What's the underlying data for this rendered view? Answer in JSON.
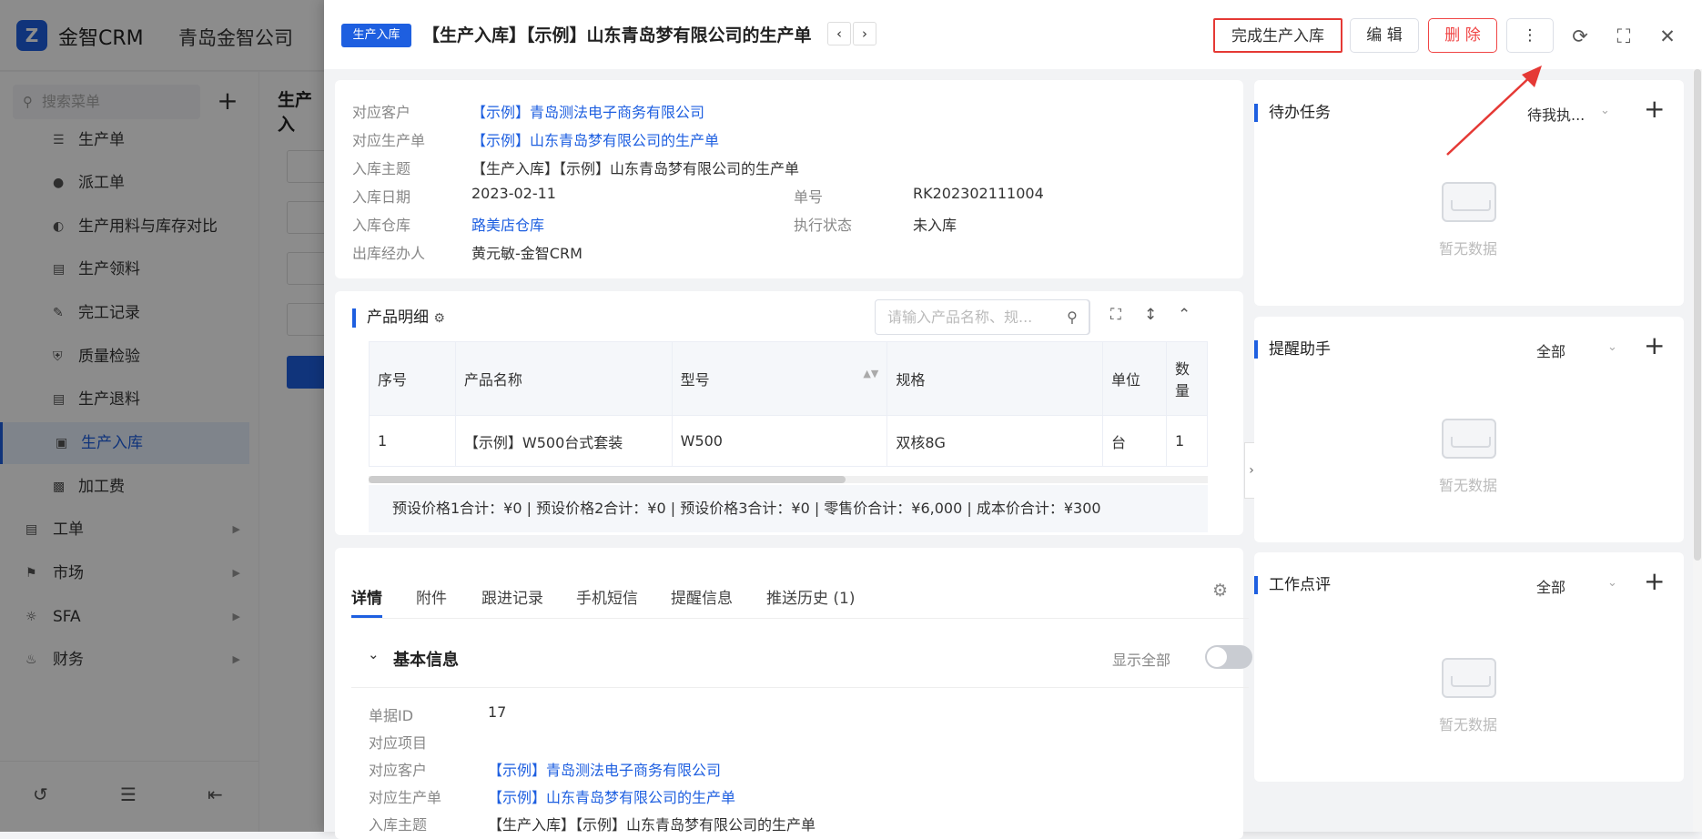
{
  "app": {
    "brand": "金智CRM",
    "company": "青岛金智公司"
  },
  "sidebar": {
    "search_placeholder": "搜索菜单",
    "items": [
      {
        "label": "生产单"
      },
      {
        "label": "派工单"
      },
      {
        "label": "生产用料与库存对比"
      },
      {
        "label": "生产领料"
      },
      {
        "label": "完工记录"
      },
      {
        "label": "质量检验"
      },
      {
        "label": "生产退料"
      },
      {
        "label": "生产入库",
        "active": true
      },
      {
        "label": "加工费"
      }
    ],
    "groups": [
      {
        "label": "工单"
      },
      {
        "label": "市场"
      },
      {
        "label": "SFA"
      },
      {
        "label": "财务"
      }
    ]
  },
  "list_pane": {
    "title": "生产入"
  },
  "header": {
    "tag": "生产入库",
    "title": "【生产入库】【示例】山东青岛梦有限公司的生产单",
    "buttons": {
      "complete": "完成生产入库",
      "edit": "编 辑",
      "delete": "删 除"
    }
  },
  "summary": {
    "fields": [
      {
        "label": "对应客户",
        "value": "【示例】青岛测法电子商务有限公司"
      },
      {
        "label": "对应生产单",
        "value": "【示例】山东青岛梦有限公司的生产单"
      },
      {
        "label": "入库主题",
        "value": "【生产入库】【示例】山东青岛梦有限公司的生产单"
      },
      {
        "label": "入库日期",
        "value": "2023-02-11"
      },
      {
        "label": "入库仓库",
        "value": "路美店仓库"
      },
      {
        "label": "出库经办人",
        "value": "黄元敏-金智CRM"
      },
      {
        "label": "单号",
        "value": "RK202302111004"
      },
      {
        "label": "执行状态",
        "value": "未入库"
      }
    ]
  },
  "products": {
    "title": "产品明细",
    "search_placeholder": "请输入产品名称、规...",
    "columns": [
      "序号",
      "产品名称",
      "型号",
      "规格",
      "单位",
      "数量"
    ],
    "rows": [
      {
        "index": "1",
        "name": "【示例】W500台式套装",
        "model": "W500",
        "spec": "双核8G",
        "unit": "台",
        "qty": "1"
      }
    ],
    "totals": "预设价格1合计：¥0 |   预设价格2合计：¥0 |   预设价格3合计：¥0 |   零售价合计：¥6,000 |   成本价合计：¥300"
  },
  "tabs": [
    {
      "label": "详情",
      "active": true
    },
    {
      "label": "附件"
    },
    {
      "label": "跟进记录"
    },
    {
      "label": "手机短信"
    },
    {
      "label": "提醒信息"
    },
    {
      "label": "推送历史 (1)"
    }
  ],
  "basic_info": {
    "title": "基本信息",
    "show_all_label": "显示全部",
    "fields": [
      {
        "label": "单据ID",
        "value": "17"
      },
      {
        "label": "对应项目",
        "value": ""
      },
      {
        "label": "对应客户",
        "value": "【示例】青岛测法电子商务有限公司"
      },
      {
        "label": "对应生产单",
        "value": "【示例】山东青岛梦有限公司的生产单"
      },
      {
        "label": "入库主题",
        "value": "【生产入库】【示例】山东青岛梦有限公司的生产单"
      }
    ]
  },
  "right_panels": [
    {
      "title": "待办任务",
      "filter": "待我执...",
      "empty": "暂无数据"
    },
    {
      "title": "提醒助手",
      "filter": "全部",
      "empty": "暂无数据"
    },
    {
      "title": "工作点评",
      "filter": "全部",
      "empty": "暂无数据"
    }
  ],
  "colors": {
    "accent": "#1e5fe0",
    "danger": "#f04545",
    "annotation": "#e53935"
  }
}
